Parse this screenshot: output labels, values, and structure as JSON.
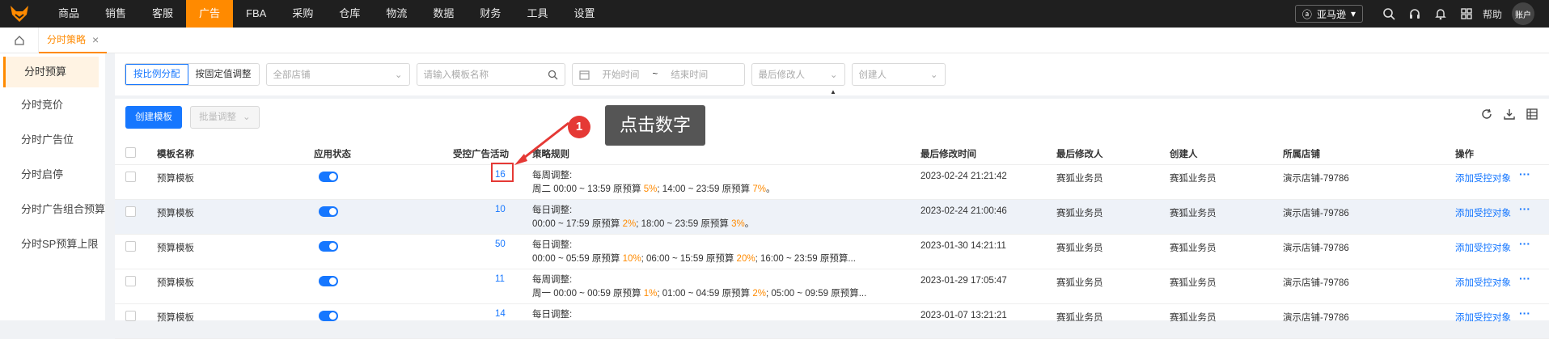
{
  "topnav": [
    "商品",
    "销售",
    "客服",
    "广告",
    "FBA",
    "采购",
    "仓库",
    "物流",
    "数据",
    "财务",
    "工具",
    "设置"
  ],
  "topnav_active": "广告",
  "site_select": "亚马逊",
  "help": "帮助",
  "account": "账户",
  "tab": {
    "label": "分时策略",
    "close": "×"
  },
  "sidebar": [
    "分时预算",
    "分时竞价",
    "分时广告位",
    "分时启停",
    "分时广告组合预算",
    "分时SP预算上限"
  ],
  "filters": {
    "alloc_ratio": "按比例分配",
    "alloc_fixed": "按固定值调整",
    "store_placeholder": "全部店铺",
    "template_placeholder": "请输入模板名称",
    "start_time": "开始时间",
    "range_sep": "~",
    "end_time": "结束时间",
    "last_modifier": "最后修改人",
    "creator": "创建人"
  },
  "toolbar": {
    "create": "创建模板",
    "batch": "批量调整"
  },
  "columns": [
    "模板名称",
    "应用状态",
    "受控广告活动",
    "策略规则",
    "最后修改时间",
    "最后修改人",
    "创建人",
    "所属店铺",
    "操作"
  ],
  "rows": [
    {
      "name": "预算模板",
      "count": "16",
      "rule_title": "每周调整:",
      "rule_parts": [
        "周二 00:00 ~ 13:59 原预算 ",
        "5%",
        "; 14:00 ~ 23:59 原预算 ",
        "7%",
        "。"
      ],
      "time": "2023-02-24 21:21:42",
      "modifier": "赛狐业务员",
      "creator": "赛狐业务员",
      "store": "演示店铺-79786",
      "action": "添加受控对象"
    },
    {
      "name": "预算模板",
      "count": "10",
      "rule_title": "每日调整:",
      "rule_parts": [
        "00:00 ~ 17:59 原预算 ",
        "2%",
        "; 18:00 ~ 23:59 原预算 ",
        "3%",
        "。"
      ],
      "time": "2023-02-24 21:00:46",
      "modifier": "赛狐业务员",
      "creator": "赛狐业务员",
      "store": "演示店铺-79786",
      "action": "添加受控对象"
    },
    {
      "name": "预算模板",
      "count": "50",
      "rule_title": "每日调整:",
      "rule_parts": [
        "00:00 ~ 05:59 原预算 ",
        "10%",
        "; 06:00 ~ 15:59 原预算 ",
        "20%",
        "; 16:00 ~ 23:59 原预算..."
      ],
      "time": "2023-01-30 14:21:11",
      "modifier": "赛狐业务员",
      "creator": "赛狐业务员",
      "store": "演示店铺-79786",
      "action": "添加受控对象"
    },
    {
      "name": "预算模板",
      "count": "11",
      "rule_title": "每周调整:",
      "rule_parts": [
        "周一 00:00 ~ 00:59 原预算 ",
        "1%",
        "; 01:00 ~ 04:59 原预算 ",
        "2%",
        "; 05:00 ~ 09:59 原预算..."
      ],
      "time": "2023-01-29 17:05:47",
      "modifier": "赛狐业务员",
      "creator": "赛狐业务员",
      "store": "演示店铺-79786",
      "action": "添加受控对象"
    },
    {
      "name": "预算模板",
      "count": "14",
      "rule_title": "每日调整:",
      "rule_parts": [
        "",
        "",
        "",
        "",
        ""
      ],
      "time": "2023-01-07 13:21:21",
      "modifier": "赛狐业务员",
      "creator": "赛狐业务员",
      "store": "演示店铺-79786",
      "action": "添加受控对象"
    }
  ],
  "annotation": {
    "number": "1",
    "text": "点击数字"
  },
  "colors": {
    "accent": "#ff8a00",
    "primary": "#1677ff",
    "topbar": "#1f1f1f",
    "marker": "#e53935"
  }
}
